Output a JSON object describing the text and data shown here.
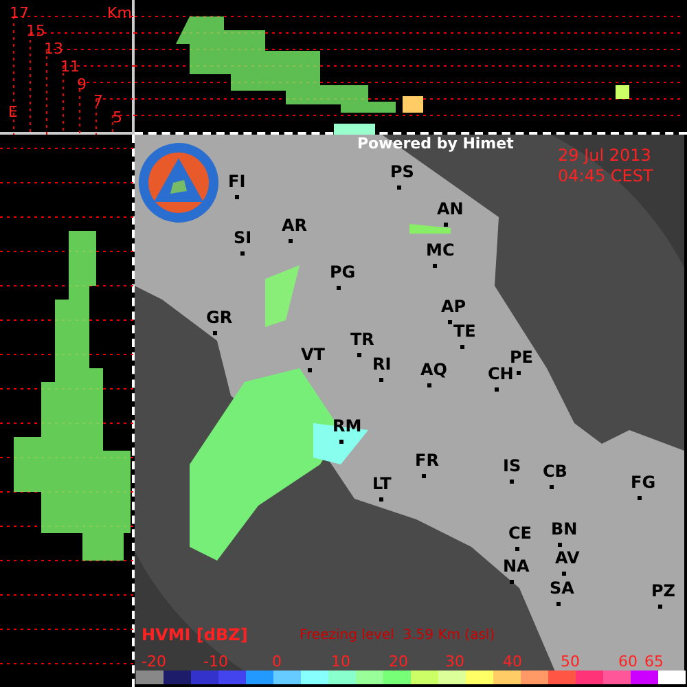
{
  "vertical_profile": {
    "unit": "Km",
    "direction_label": "E",
    "height_labels": [
      "17",
      "15",
      "13",
      "11",
      "9",
      "7",
      "5"
    ]
  },
  "map": {
    "credit": "Powered by Himet",
    "date": "29 Jul 2013",
    "time": "04:45 CEST",
    "cities": [
      {
        "label": "FI"
      },
      {
        "label": "PS"
      },
      {
        "label": "AN"
      },
      {
        "label": "AR"
      },
      {
        "label": "SI"
      },
      {
        "label": "MC"
      },
      {
        "label": "PG"
      },
      {
        "label": "GR"
      },
      {
        "label": "AP"
      },
      {
        "label": "TE"
      },
      {
        "label": "TR"
      },
      {
        "label": "VT"
      },
      {
        "label": "PE"
      },
      {
        "label": "RI"
      },
      {
        "label": "AQ"
      },
      {
        "label": "CH"
      },
      {
        "label": "RM"
      },
      {
        "label": "FR"
      },
      {
        "label": "IS"
      },
      {
        "label": "CB"
      },
      {
        "label": "LT"
      },
      {
        "label": "FG"
      },
      {
        "label": "BN"
      },
      {
        "label": "CE"
      },
      {
        "label": "AV"
      },
      {
        "label": "NA"
      },
      {
        "label": "SA"
      },
      {
        "label": "PZ"
      }
    ]
  },
  "legend": {
    "title": "HVMI [dBZ]",
    "freezing_level": "Freezing level  3.59 Km (asl)",
    "ticks": [
      "-20",
      "-10",
      "0",
      "10",
      "20",
      "30",
      "40",
      "50",
      "60",
      "65"
    ],
    "swatches": [
      {
        "color": "#888888"
      },
      {
        "color": "#1c1c6a"
      },
      {
        "color": "#3333cc"
      },
      {
        "color": "#4444ee"
      },
      {
        "color": "#2299ff"
      },
      {
        "color": "#66ccff"
      },
      {
        "color": "#88ffff"
      },
      {
        "color": "#88ffcc"
      },
      {
        "color": "#99ff99"
      },
      {
        "color": "#77ff77"
      },
      {
        "color": "#ccff66"
      },
      {
        "color": "#ddff99"
      },
      {
        "color": "#ffff66"
      },
      {
        "color": "#ffcc66"
      },
      {
        "color": "#ff9966"
      },
      {
        "color": "#ff5544"
      },
      {
        "color": "#ff3377"
      },
      {
        "color": "#ff5599"
      },
      {
        "color": "#cc00ff"
      },
      {
        "color": "#ffffff"
      }
    ]
  }
}
